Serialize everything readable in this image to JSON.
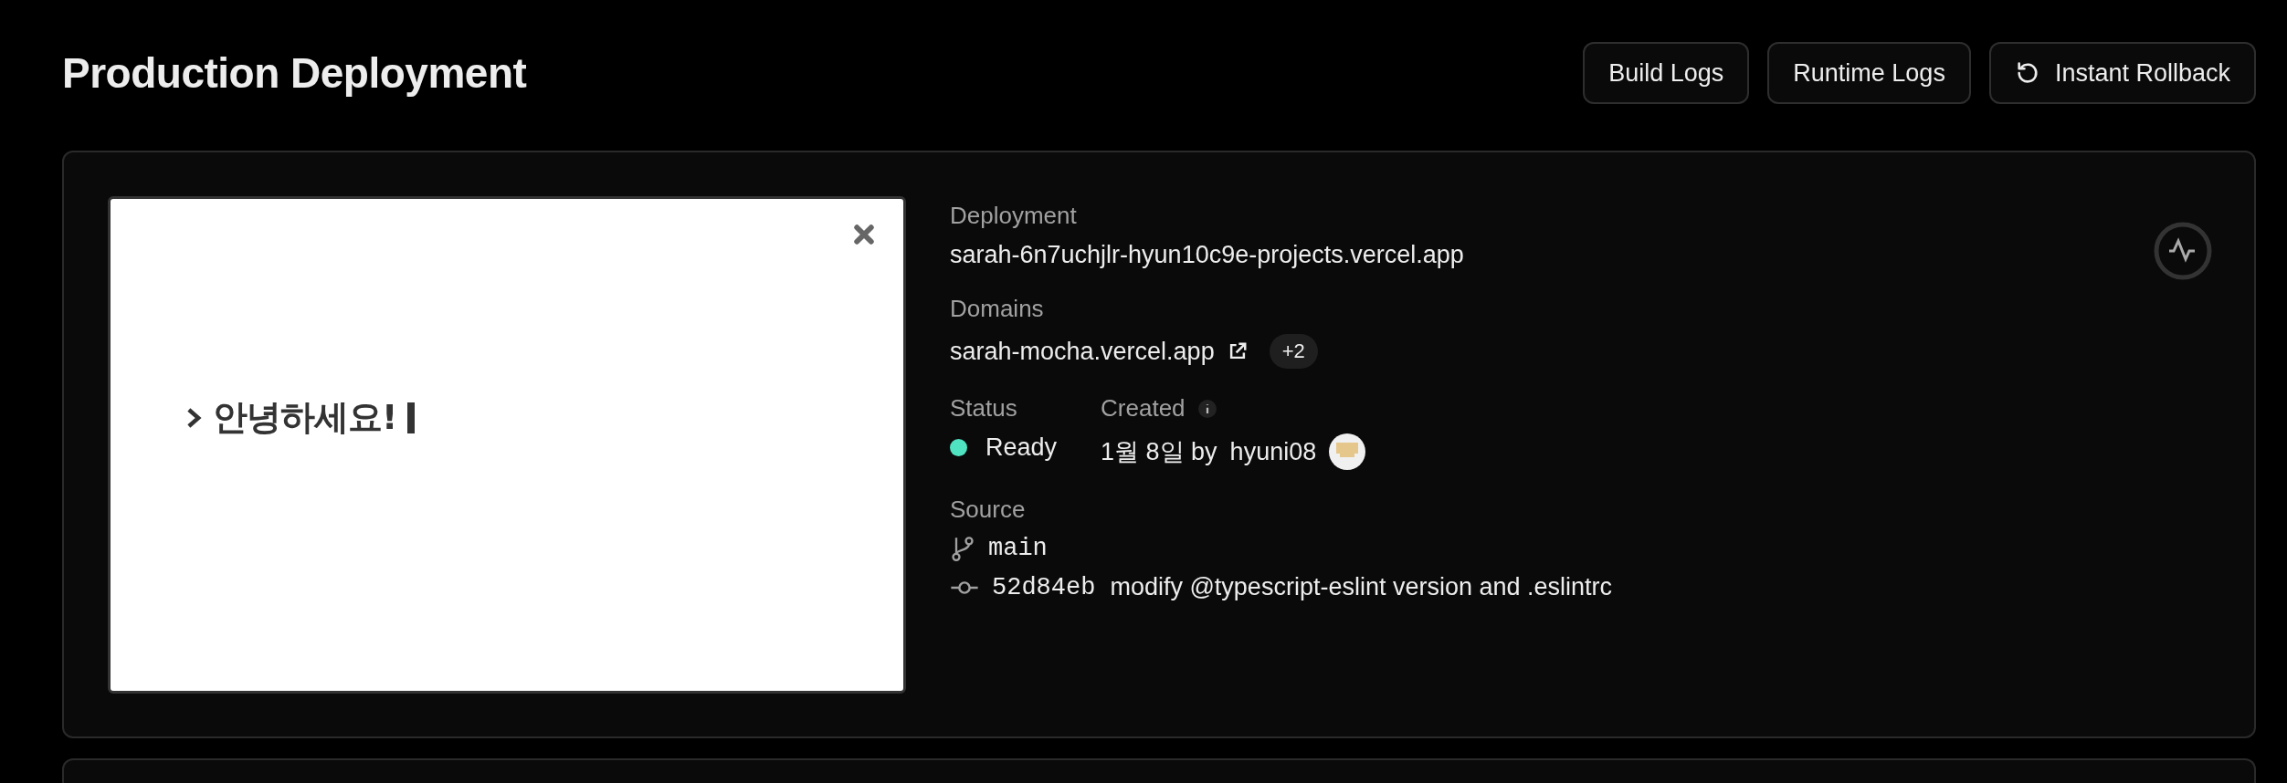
{
  "header": {
    "title": "Production Deployment",
    "buttons": [
      {
        "label": "Build Logs",
        "kind": "plain"
      },
      {
        "label": "Runtime Logs",
        "kind": "plain"
      },
      {
        "label": "Instant Rollback",
        "kind": "rollback"
      }
    ]
  },
  "preview": {
    "text": "안녕하세요!"
  },
  "deployment": {
    "label": "Deployment",
    "url": "sarah-6n7uchjlr-hyun10c9e-projects.vercel.app"
  },
  "domains": {
    "label": "Domains",
    "domain": "sarah-mocha.vercel.app",
    "extra_count": "+2"
  },
  "status": {
    "label": "Status",
    "value": "Ready",
    "color": "#50e3c2"
  },
  "created": {
    "label": "Created",
    "date": "1월 8일 by",
    "author": "hyuni08"
  },
  "source": {
    "label": "Source",
    "branch": "main",
    "commit_hash": "52d84eb",
    "commit_message": "modify @typescript-eslint version and .eslintrc"
  }
}
